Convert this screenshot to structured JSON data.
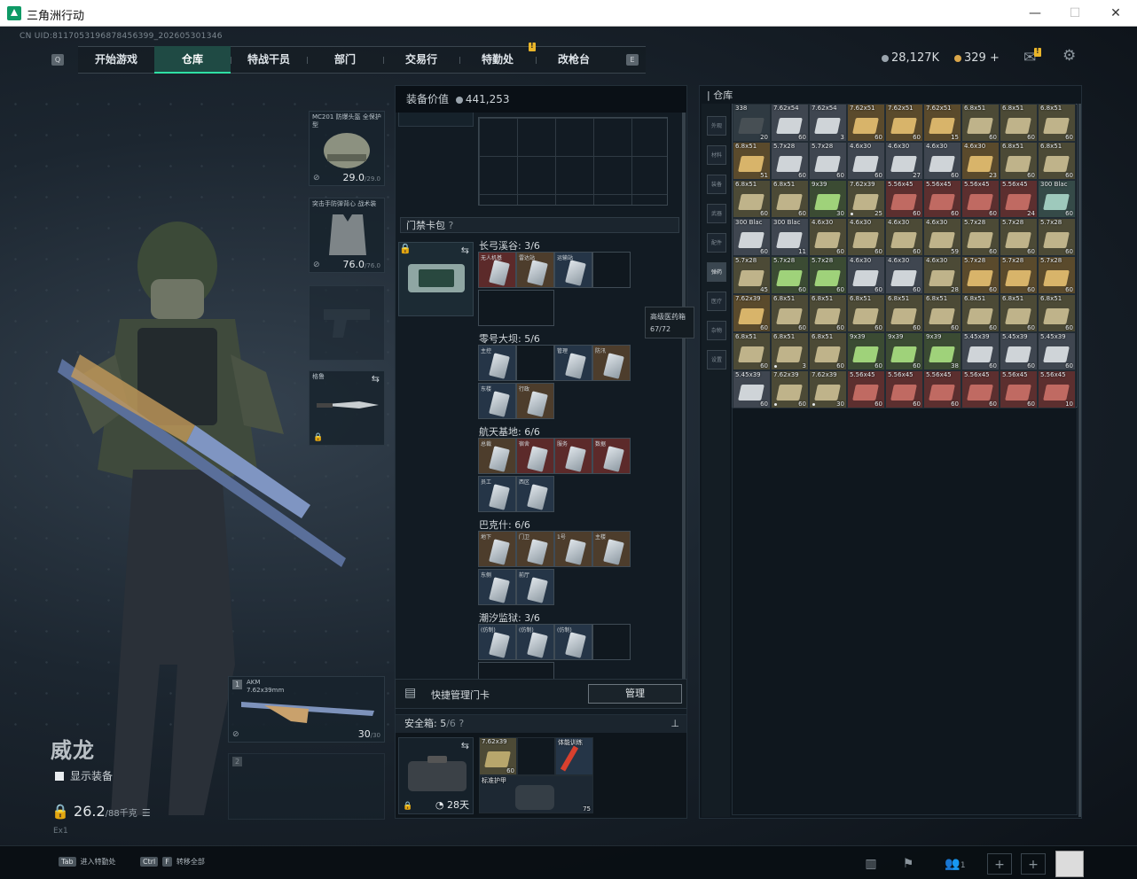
{
  "window": {
    "title": "三角洲行动",
    "min": "—",
    "max": "☐",
    "close": "✕"
  },
  "uid": "CN UID:811705319687845639​9_202605301346",
  "nav": {
    "left_key": "Q",
    "right_key": "E",
    "tabs": [
      {
        "label": "开始游戏"
      },
      {
        "label": "仓库",
        "active": true
      },
      {
        "label": "特战干员"
      },
      {
        "label": "部门"
      },
      {
        "label": "交易行"
      },
      {
        "label": "特勤处"
      },
      {
        "label": "改枪台"
      }
    ]
  },
  "currency": {
    "silver": "28,127K",
    "gold": "329",
    "plus": "+"
  },
  "operator": {
    "name": "威龙",
    "show_equipment": "显示装备",
    "weight": "26.2",
    "weight_max": "/88千克",
    "level": "Ex1"
  },
  "gear": {
    "helmet": {
      "name": "MC201 防爆头盔 全保护型",
      "value": "29.0",
      "max": "/29.0"
    },
    "armor": {
      "name": "突击手防弹背心 战术装",
      "value": "76.0",
      "max": "/76.0"
    },
    "knife": {
      "name": "格鲁"
    },
    "primary": {
      "slot": "1",
      "name": "AKM",
      "sub": "7.62x39mm",
      "ammo": "30",
      "ammo_max": "/30"
    },
    "secondary": {
      "slot": "2"
    }
  },
  "equip_value": {
    "label": "装备价值",
    "value": "441,253"
  },
  "keycard_pack": {
    "label": "门禁卡包",
    "help": "?"
  },
  "maps": [
    {
      "label": "长弓溪谷: 3/6",
      "cells": [
        {
          "t": "无人机基",
          "c": "red"
        },
        {
          "t": "雷达站",
          "c": "tan"
        },
        {
          "t": "运输站",
          "c": "blu"
        },
        {
          "t": "",
          "c": "empty"
        }
      ]
    },
    {
      "label": "零号大坝: 5/6",
      "cells": [
        {
          "t": "主控",
          "c": "blu"
        },
        {
          "t": "",
          "c": "empty"
        },
        {
          "t": "管理",
          "c": "blu"
        },
        {
          "t": "防汛",
          "c": "tan"
        },
        {
          "t": "东楼",
          "c": "blu"
        },
        {
          "t": "行政",
          "c": "tan"
        }
      ]
    },
    {
      "label": "航天基地: 6/6",
      "cells": [
        {
          "t": "总裁",
          "c": "tan"
        },
        {
          "t": "宿舍",
          "c": "red"
        },
        {
          "t": "服务",
          "c": "red"
        },
        {
          "t": "数据",
          "c": "red"
        },
        {
          "t": "员工",
          "c": "blu"
        },
        {
          "t": "西区",
          "c": "blu"
        }
      ]
    },
    {
      "label": "巴克什: 6/6",
      "cells": [
        {
          "t": "地下",
          "c": "tan"
        },
        {
          "t": "门卫",
          "c": "tan"
        },
        {
          "t": "1号",
          "c": "tan"
        },
        {
          "t": "主楼",
          "c": "tan"
        },
        {
          "t": "东侧",
          "c": "blu"
        },
        {
          "t": "前厅",
          "c": "blu"
        }
      ]
    },
    {
      "label": "潮汐监狱: 3/6",
      "cells": [
        {
          "t": "(仿制)",
          "c": "blu"
        },
        {
          "t": "(仿制)",
          "c": "blu"
        },
        {
          "t": "(仿制)",
          "c": "blu"
        },
        {
          "t": "",
          "c": "empty"
        }
      ]
    }
  ],
  "tooltip": {
    "line1": "高级医药箱",
    "line2": "67/72"
  },
  "quick_keycard": {
    "label": "快捷管理门卡",
    "button": "管理"
  },
  "safe_box": {
    "label": "安全箱: ",
    "count": "5",
    "max": "/6",
    "help": "?",
    "days": "28天",
    "item1": {
      "name": "7.62x39",
      "count": "60"
    },
    "item2": {
      "name": "体能训练",
      "count": ""
    },
    "item3": {
      "name": "标准护甲",
      "count": "75"
    }
  },
  "warehouse": {
    "label": "仓库",
    "side": [
      "外观",
      "材料",
      "装备",
      "武器",
      "配件",
      "弹药",
      "医疗",
      "杂物",
      "设置"
    ]
  },
  "ammo": [
    [
      "338|20|gray",
      "7.62x54|60|white",
      "7.62x54|3|white",
      "7.62x51|60|gold",
      "7.62x51|60|gold",
      "7.62x51|15|gold",
      "6.8x51|60|olive",
      "6.8x51|60|olive",
      "6.8x51|60|olive"
    ],
    [
      "6.8x51|51|gold",
      "5.7x28|60|white",
      "5.7x28|60|white",
      "4.6x30|60|white",
      "4.6x30|27|white",
      "4.6x30|60|white",
      "4.6x30|23|gold",
      "6.8x51|60|olive",
      "6.8x51|60|olive"
    ],
    [
      "6.8x51|60|olive",
      "6.8x51|60|olive",
      "9x39|30|green",
      "7.62x39|25|olive",
      "5.56x45|60|red",
      "5.56x45|60|red",
      "5.56x45|60|red",
      "5.56x45|24|red",
      "300 Blac|60|teal"
    ],
    [
      "300 Blac|60|white",
      "300 Blac|11|white",
      "4.6x30|60|olive",
      "4.6x30|60|olive",
      "4.6x30|60|olive",
      "4.6x30|59|olive",
      "5.7x28|60|olive",
      "5.7x28|60|olive",
      "5.7x28|60|olive"
    ],
    [
      "5.7x28|45|olive",
      "5.7x28|60|green",
      "5.7x28|60|green",
      "4.6x30|60|white",
      "4.6x30|60|white",
      "4.6x30|28|olive",
      "5.7x28|60|gold",
      "5.7x28|60|gold",
      "5.7x28|60|gold"
    ],
    [
      "7.62x39|60|gold",
      "6.8x51|60|olive",
      "6.8x51|60|olive",
      "6.8x51|60|olive",
      "6.8x51|60|olive",
      "6.8x51|60|olive",
      "6.8x51|60|olive",
      "6.8x51|60|olive",
      "6.8x51|60|olive"
    ],
    [
      "6.8x51|60|olive",
      "6.8x51|3|olive",
      "6.8x51|60|olive",
      "9x39|60|green",
      "9x39|60|green",
      "9x39|38|green",
      "5.45x39|60|white",
      "5.45x39|60|white",
      "5.45x39|60|white"
    ],
    [
      "5.45x39|60|white",
      "7.62x39|60|olive",
      "7.62x39|30|olive",
      "5.56x45|60|red",
      "5.56x45|60|red",
      "5.56x45|60|red",
      "5.56x45|60|red",
      "5.56x45|60|red",
      "5.56x45|10|red"
    ]
  ],
  "dots": [
    [
      2,
      3
    ],
    [
      6,
      1
    ],
    [
      7,
      1
    ],
    [
      7,
      2
    ]
  ],
  "bottom": {
    "k1": "Tab",
    "a1": "进入特勤处",
    "k2": "Ctrl",
    "k2b": "F",
    "a2": "转移全部",
    "friends": "1",
    "plus": "+"
  },
  "colors": {
    "accent": "#2fe0a4",
    "alert": "#e9b52a"
  }
}
